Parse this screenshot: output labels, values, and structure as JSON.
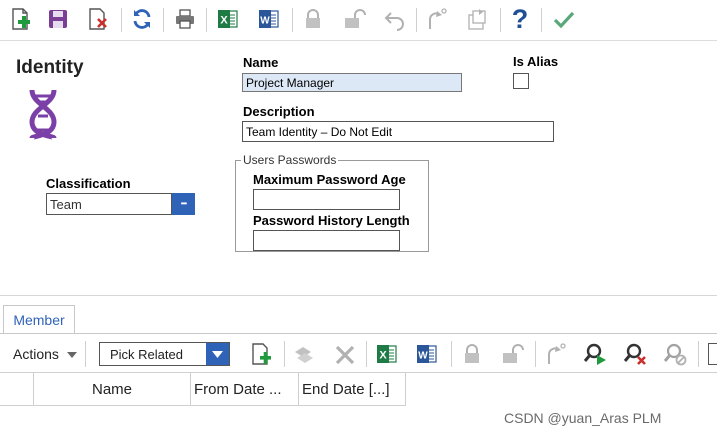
{
  "toolbar": {
    "icons": [
      "new-icon",
      "save-icon",
      "delete-icon",
      "refresh-icon",
      "print-icon",
      "excel-icon",
      "word-icon",
      "lock-icon",
      "unlock-icon",
      "undo-icon",
      "promote-icon",
      "version-icon",
      "help-icon",
      "done-icon"
    ],
    "excel_letter": "X",
    "word_letter": "W",
    "help_char": "?"
  },
  "form": {
    "item_type": "Identity",
    "name_label": "Name",
    "name_value": "Project Manager",
    "is_alias_label": "Is Alias",
    "description_label": "Description",
    "description_value": "Team Identity – Do Not Edit",
    "classification_label": "Classification",
    "classification_value": "Team",
    "ellipsis": "•••",
    "users_passwords_legend": "Users Passwords",
    "max_password_age_label": "Maximum Password Age",
    "max_password_age_value": "",
    "password_history_label": "Password History Length",
    "password_history_value": ""
  },
  "relationships": {
    "tab_label": "Member",
    "actions_label": "Actions",
    "pick_related_value": "Pick Related",
    "excel_letter": "X",
    "word_letter": "W",
    "columns": [
      "Name",
      "From Date ...",
      "End Date [...]"
    ]
  },
  "watermark": "CSDN @yuan_Aras PLM",
  "colors": {
    "accent_blue": "#2f63b8",
    "excel_green": "#1e7b45",
    "word_blue": "#2b579a",
    "dna_purple": "#7b3fa8",
    "name_field_bg": "#dde8f6",
    "done_green": "#5aa77a"
  }
}
